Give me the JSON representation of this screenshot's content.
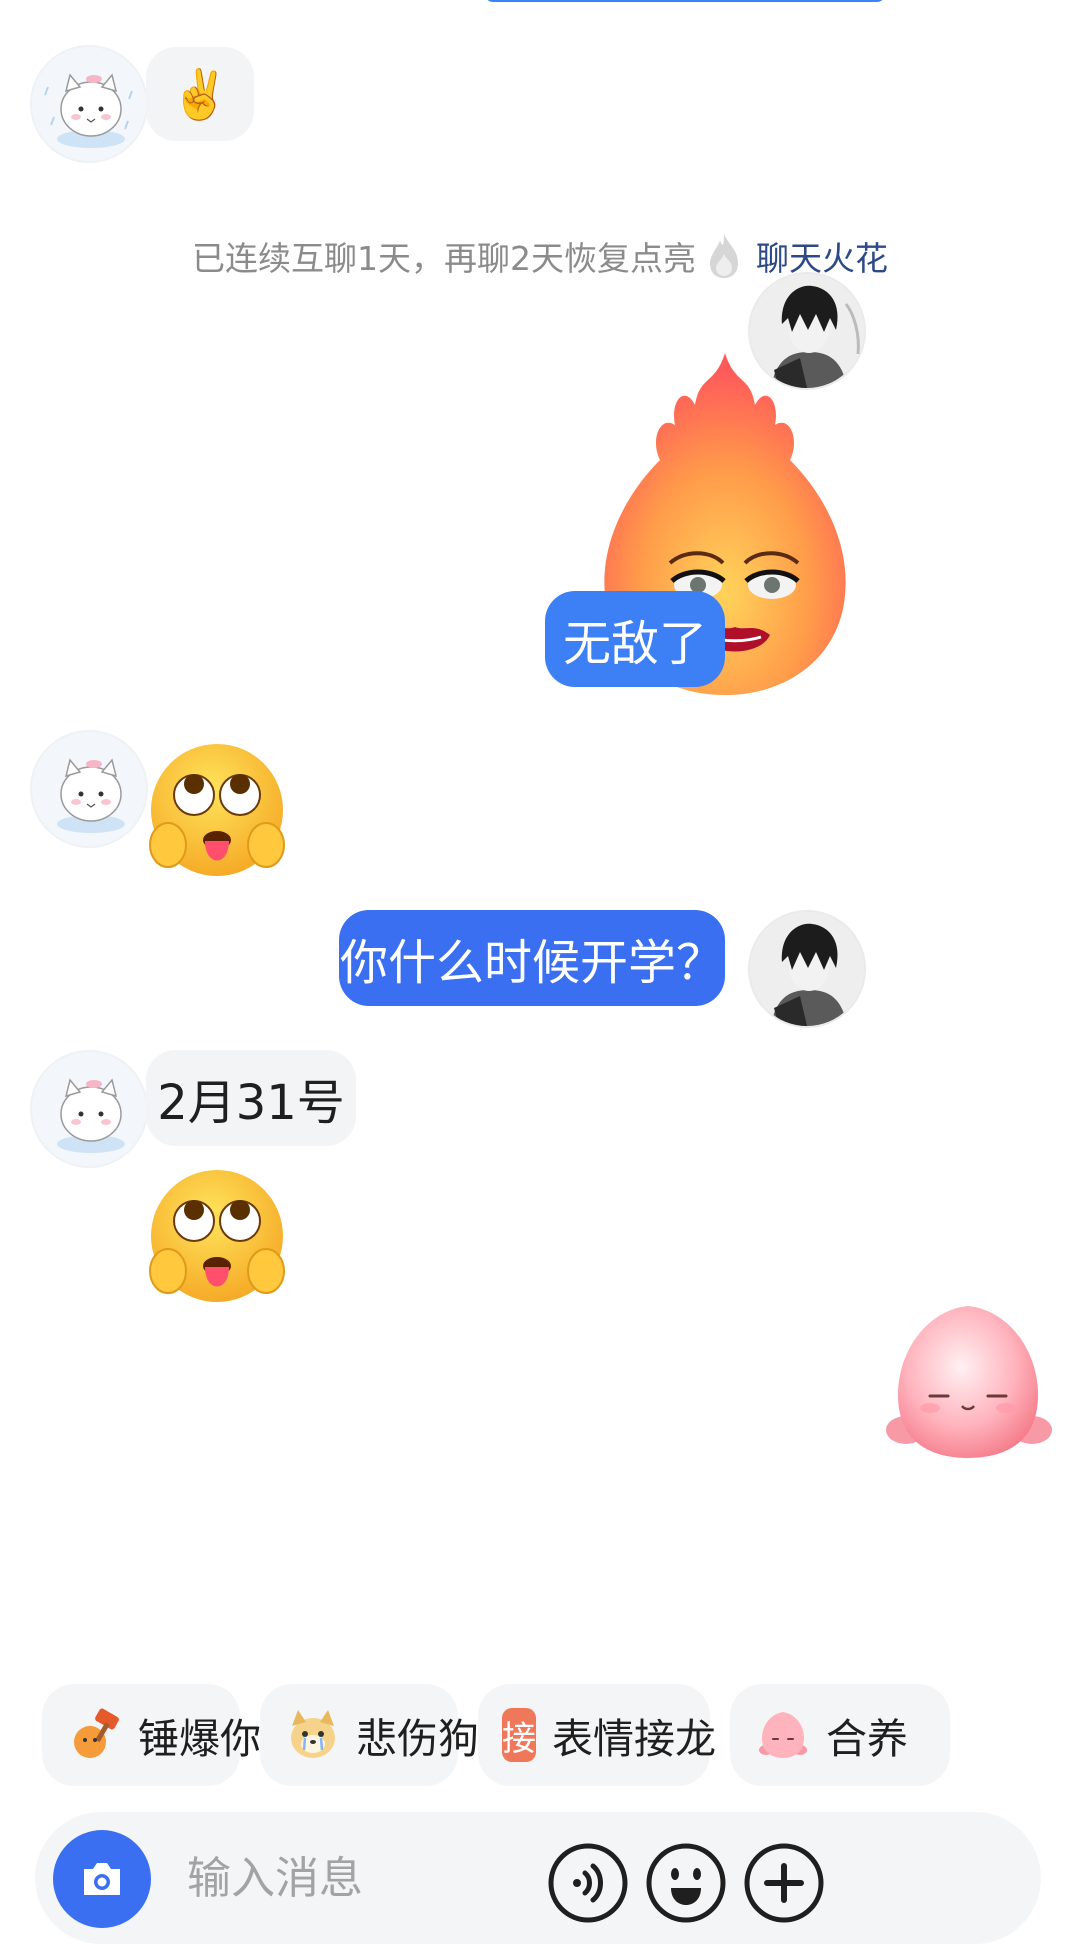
{
  "messages": {
    "peer_victory_emoji": "✌️",
    "streak_notice": "已连续互聊1天，再聊2天恢复点亮",
    "streak_link": "聊天火花",
    "me_invincible": "无敌了",
    "me_question": "你什么时候开学？",
    "peer_reply": "2月31号"
  },
  "chips": [
    {
      "label": "锤爆你",
      "icon": "hammer-sticker-icon"
    },
    {
      "label": "悲伤狗",
      "icon": "sad-dog-icon"
    },
    {
      "label": "表情接龙",
      "icon": "jie-badge-icon",
      "badge": "接"
    },
    {
      "label": "合养",
      "icon": "peach-pet-icon"
    }
  ],
  "input": {
    "placeholder": "输入消息"
  },
  "colors": {
    "accent": "#3d7ff4",
    "link": "#2d4a86",
    "bubble_bg": "#f3f4f6"
  }
}
